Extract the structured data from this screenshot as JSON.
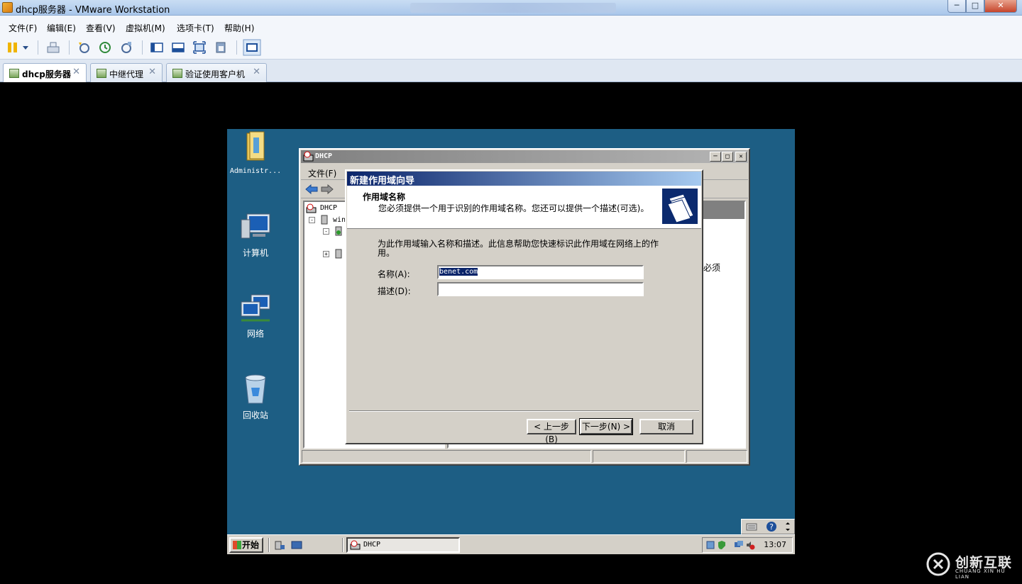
{
  "host": {
    "title": "dhcp服务器 - VMware Workstation",
    "menu": [
      "文件(F)",
      "编辑(E)",
      "查看(V)",
      "虚拟机(M)",
      "选项卡(T)",
      "帮助(H)"
    ],
    "tabs": [
      {
        "label": "dhcp服务器",
        "active": true
      },
      {
        "label": "中继代理",
        "active": false
      },
      {
        "label": "验证使用客户机",
        "active": false
      }
    ]
  },
  "desktop": {
    "icons": [
      "Administr...",
      "计算机",
      "网络",
      "回收站"
    ]
  },
  "mmc": {
    "title": "DHCP",
    "menu_file": "文件(F)",
    "tree_root": "DHCP",
    "tree_server": "win",
    "right_peek": "必须"
  },
  "wizard": {
    "title": "新建作用域向导",
    "heading": "作用域名称",
    "subheading": "您必须提供一个用于识别的作用域名称。您还可以提供一个描述(可选)。",
    "instructions": "为此作用域输入名称和描述。此信息帮助您快速标识此作用域在网络上的作用。",
    "name_label": "名称(A):",
    "name_value": "benet.com",
    "desc_label": "描述(D):",
    "desc_value": "",
    "back_button": "< 上一步(B)",
    "next_button": "下一步(N) >",
    "cancel_button": "取消"
  },
  "taskbar": {
    "start": "开始",
    "task": "DHCP",
    "clock": "13:07"
  },
  "watermark": {
    "text": "创新互联",
    "sub": "CHUANG XIN HU LIAN"
  }
}
